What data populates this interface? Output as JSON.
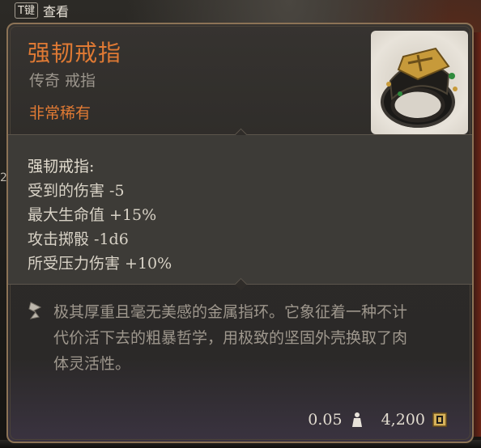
{
  "hint": {
    "key": "T键",
    "label": "查看"
  },
  "background": {
    "left_edge_glyph": "2"
  },
  "item": {
    "name": "强韧戒指",
    "category": "传奇 戒指",
    "rarity": "非常稀有",
    "rarity_color": "#e07a34",
    "icon": "ring-icon"
  },
  "stats": {
    "title": "强韧戒指:",
    "lines": [
      "受到的伤害 -5",
      "最大生命值 +15%",
      "攻击掷骰 -1d6",
      "所受压力伤害 +10%"
    ]
  },
  "description": {
    "icon": "quill-icon",
    "text": "极其厚重且毫无美感的金属指环。它象征着一种不计\n代价活下去的粗暴哲学，用极致的坚固外壳换取了肉\n体灵活性。"
  },
  "footer": {
    "weight": "0.05",
    "weight_icon": "weight-icon",
    "value": "4,200",
    "value_icon": "gold-coin-icon"
  }
}
